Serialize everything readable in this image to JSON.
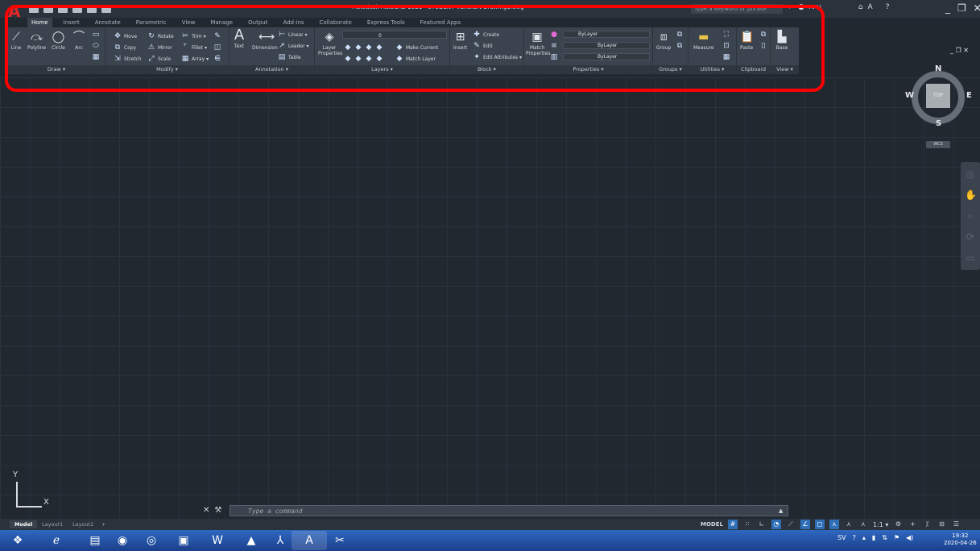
{
  "window": {
    "title": "Autodesk AutoCAD 2021 - STUDENT VERSION   Drawing1.dwg",
    "search_placeholder": "Type a keyword or phrase",
    "user": "AAU"
  },
  "tabs": [
    "Home",
    "Insert",
    "Annotate",
    "Parametric",
    "View",
    "Manage",
    "Output",
    "Add-ins",
    "Collaborate",
    "Express Tools",
    "Featured Apps"
  ],
  "active_tab": "Home",
  "ribbon": {
    "draw": {
      "title": "Draw ▾",
      "tools": [
        "Line",
        "Polyline",
        "Circle",
        "Arc"
      ]
    },
    "modify": {
      "title": "Modify ▾",
      "tools": [
        "Move",
        "Rotate",
        "Trim ▾",
        "Copy",
        "Mirror",
        "Fillet ▾",
        "Stretch",
        "Scale",
        "Array ▾"
      ]
    },
    "annotation": {
      "title": "Annotation ▾",
      "tools": [
        "Text",
        "Dimension",
        "Linear ▾",
        "Leader ▾",
        "Table"
      ]
    },
    "layers": {
      "title": "Layers ▾",
      "tools": [
        "Layer Properties",
        "Make Current",
        "Match Layer"
      ],
      "combo_value": "0"
    },
    "block": {
      "title": "Block ▾",
      "tools": [
        "Insert",
        "Create",
        "Edit",
        "Edit Attributes ▾"
      ]
    },
    "properties": {
      "title": "Properties ▾",
      "tools": [
        "Match Properties"
      ],
      "color": "ByLayer",
      "linetype": "ByLayer",
      "lineweight": "ByLayer"
    },
    "groups": {
      "title": "Groups ▾",
      "tools": [
        "Group"
      ]
    },
    "utilities": {
      "title": "Utilities ▾",
      "tools": [
        "Measure"
      ]
    },
    "clipboard": {
      "title": "Clipboard",
      "tools": [
        "Paste"
      ]
    },
    "view": {
      "title": "View ▾",
      "tools": [
        "Base"
      ]
    }
  },
  "viewcube": {
    "north": "N",
    "south": "S",
    "east": "E",
    "west": "W",
    "face": "TOP",
    "wcs": "WCS"
  },
  "ucs": {
    "x": "X",
    "y": "Y"
  },
  "command": {
    "placeholder": "Type a command"
  },
  "layout_tabs": [
    "Model",
    "Layout1",
    "Layout2",
    "+"
  ],
  "status": {
    "model": "MODEL",
    "scale": "1:1 ▾"
  },
  "taskbar": {
    "lang": "SV",
    "time": "19:32",
    "date": "2020-04-26"
  },
  "colors": {
    "accent_red": "#ff0000",
    "canvas": "#212830",
    "ribbon": "#3b444e",
    "taskbar": "#1f4ea1"
  }
}
